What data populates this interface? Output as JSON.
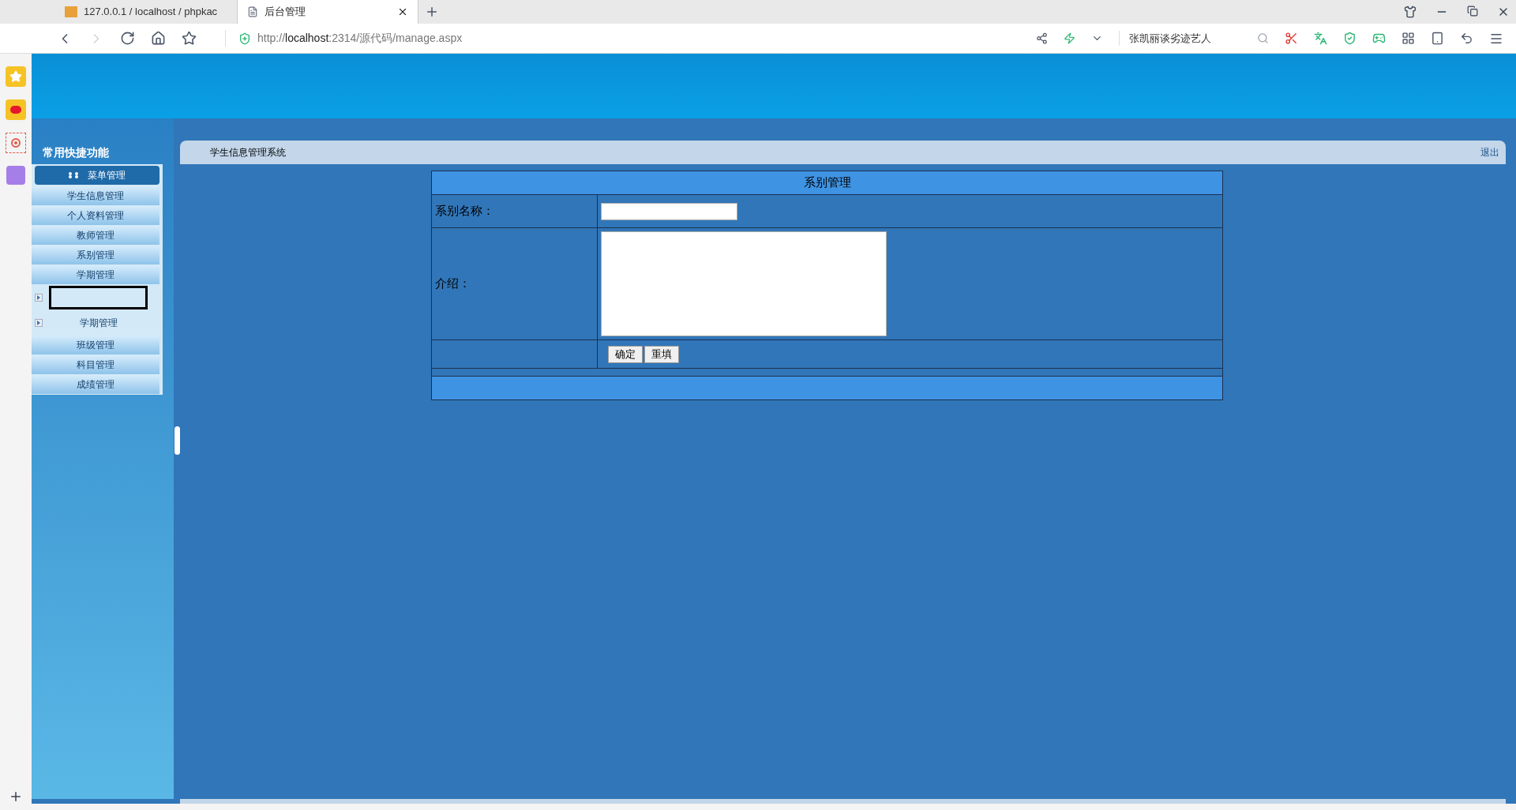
{
  "browser": {
    "tabs": [
      {
        "label": "127.0.0.1 / localhost / phpkac",
        "selected": false
      },
      {
        "label": "后台管理",
        "selected": true
      }
    ],
    "url": {
      "host": "localhost",
      "rest": ":2314/源代码/manage.aspx",
      "scheme": "http://"
    },
    "search": "张凯丽谈劣迹艺人"
  },
  "sidebar": {
    "title": "常用快捷功能",
    "menu_header": "菜单管理",
    "items": [
      {
        "label": "学生信息管理"
      },
      {
        "label": "个人资料管理"
      },
      {
        "label": "教师管理"
      },
      {
        "label": "系别管理"
      },
      {
        "label": "学期管理",
        "children": [
          {
            "selected": true
          },
          {
            "label": "学期管理",
            "selected": false
          }
        ]
      },
      {
        "label": "班级管理"
      },
      {
        "label": "科目管理"
      },
      {
        "label": "成绩管理"
      }
    ]
  },
  "topbar": {
    "title": "学生信息管理系统",
    "logout": "退出"
  },
  "form": {
    "title": "系别管理",
    "name_label": "系别名称：",
    "intro_label": "介绍：",
    "buttons": [
      "确定",
      "重填"
    ]
  }
}
